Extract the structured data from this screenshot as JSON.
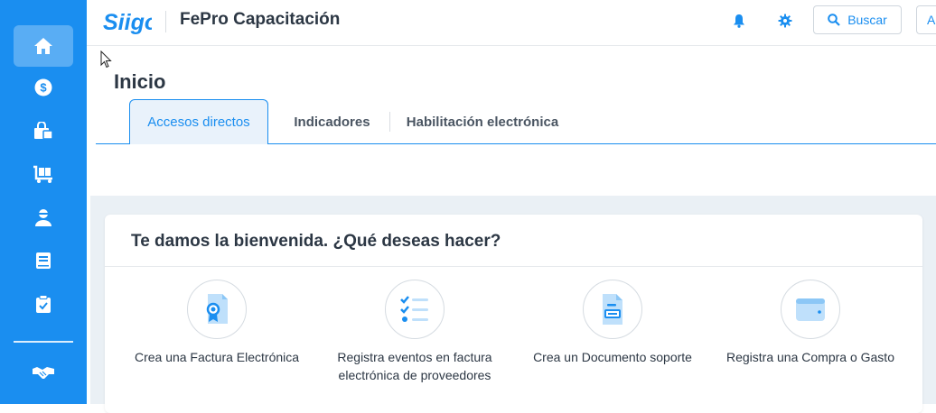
{
  "header": {
    "app_title": "FePro Capacitación",
    "search_label": "Buscar",
    "extra_button_label": "A"
  },
  "sidebar": {
    "items": [
      {
        "name": "home",
        "icon": "home-icon",
        "active": true
      },
      {
        "name": "sales",
        "icon": "dollar-icon"
      },
      {
        "name": "purchases",
        "icon": "shopping-bag-icon"
      },
      {
        "name": "inventory",
        "icon": "cart-icon"
      },
      {
        "name": "contacts",
        "icon": "user-icon"
      },
      {
        "name": "accounting",
        "icon": "book-icon"
      },
      {
        "name": "tasks",
        "icon": "clipboard-check-icon"
      },
      {
        "name": "partners",
        "icon": "handshake-icon"
      }
    ]
  },
  "page": {
    "title": "Inicio",
    "tabs": [
      {
        "label": "Accesos directos",
        "active": true
      },
      {
        "label": "Indicadores"
      },
      {
        "label": "Habilitación electrónica"
      }
    ]
  },
  "welcome": {
    "title": "Te damos la bienvenida. ¿Qué deseas hacer?",
    "actions": [
      {
        "label": "Crea una Factura Electrónica",
        "icon": "invoice-icon"
      },
      {
        "label": "Registra eventos en factura electrónica de proveedores",
        "icon": "checklist-icon"
      },
      {
        "label": "Crea un Documento soporte",
        "icon": "document-icon"
      },
      {
        "label": "Registra una Compra o Gasto",
        "icon": "wallet-icon"
      }
    ]
  },
  "colors": {
    "brand": "#1a8ef0",
    "text": "#2c3744",
    "content_bg": "#eaf0f5"
  }
}
